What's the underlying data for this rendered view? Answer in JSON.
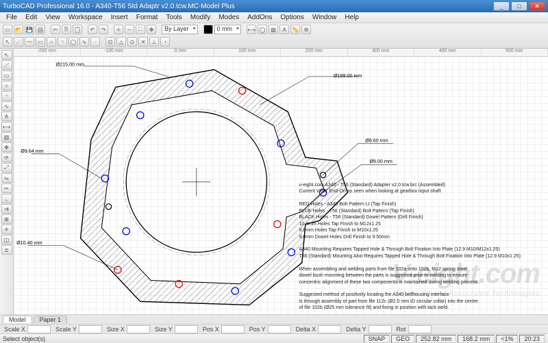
{
  "title": "TurboCAD Professional 16.0 - A340-T56 Std Adaptr v2.0.tcw.MC-Model Plus",
  "menus": [
    "File",
    "Edit",
    "View",
    "Workspace",
    "Insert",
    "Format",
    "Tools",
    "Modify",
    "Modes",
    "AddOns",
    "Options",
    "Window",
    "Help"
  ],
  "combos": {
    "layer": "By Layer",
    "width": "0 mm"
  },
  "ruler_labels": [
    "-200 mm",
    "-100 mm",
    "0 mm",
    "100 mm",
    "200 mm",
    "300 mm",
    "400 mm",
    "500 mm"
  ],
  "tabs": {
    "a": "Model",
    "b": "Paper 1"
  },
  "coord_labels": [
    "Scale X",
    "Scale Y",
    "Size X",
    "Size Y",
    "Pos X",
    "Pos Y",
    "Delta X",
    "Delta Y",
    "Rot"
  ],
  "status": {
    "prompt": "Select object(s)",
    "snap": "SNAP",
    "geo": "GEO",
    "c1": "252.82 mm",
    "c2": "168.2 mm",
    "pct": "<1%",
    "time": "20:23"
  },
  "dims": {
    "d215": "Ø215.00 mm",
    "d199": "Ø199.00 mm",
    "d9_64": "Ø9.64 mm",
    "d8_60": "Ø8.60 mm",
    "d9_00": "Ø9.00 mm",
    "d10_40": "Ø10.40 mm"
  },
  "notes": {
    "l1": "v-eight.com A340 - T56 (Standard) Adapter v2.0.tcw.brc (Assembled)",
    "l2": "Current View: End-On as seen when looking at gearbox input shaft",
    "l3": "RED Holes - A340 Bolt Pattern Lt (Tap Finish)",
    "l4": "BLUE Holes - T56 (Standard) Bolt Pattern (Tap Finish)",
    "l5": "BLACK Holes - T56 (Standard) Dowel Pattern (Drill Finish)",
    "l6": "10.4mm Holes Tap Finish to M12x1.25",
    "l7": "8.6mm Holes Tap Finish to M10x1.25",
    "l8": "9.0mm Dowel Holes Drill Finish to 9.50mm",
    "l9": "A340 Mounting Requires Tapped Hole & Through Bolt Fixation Into Plate (12.9 M10/M12x1.25)",
    "l10": "T56 (Standard) Mounting Also Requires Tapped Hole & Through Bolt Fixation Into Plate (12.9 M10x1.25)",
    "l11": "When assembling and welding parts from file 102a onto 102b, M12 spring steel",
    "l12": "dowel bush mounting between the parts is suggested prior to welding to ensure",
    "l13": "concentric alignment of these two components is maintained during welding process.",
    "l14": "Suggested method of positively locating the A340 bellhousing interface",
    "l15": "is through assembly of part from file 112c (Ø2.5 mm ID circular collar) into the centre",
    "l16": "of file 102b (Ø25 mm tolerance fit) and fixing in position with tack weld."
  },
  "watermark": {
    "big": "V-eight.com",
    "tag": "Toyota V8 and Associated Technologies"
  }
}
